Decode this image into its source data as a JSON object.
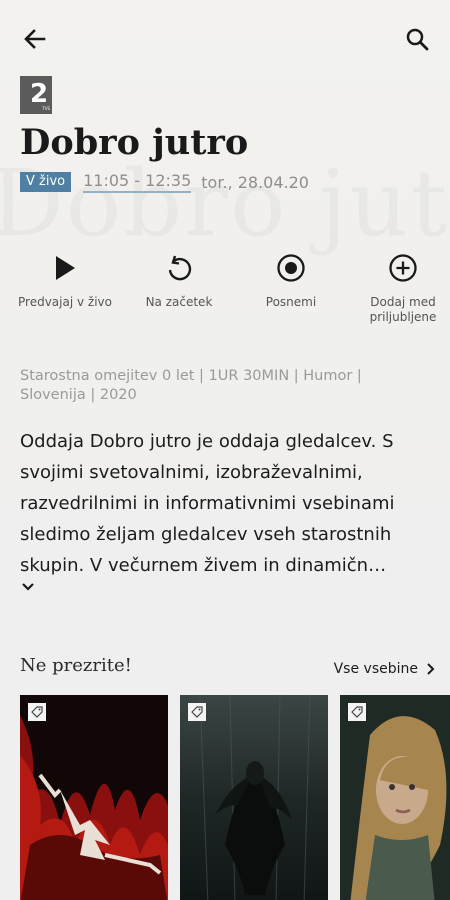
{
  "header": {
    "back_icon": "arrow-left-icon",
    "search_icon": "search-icon"
  },
  "channel": {
    "logo_number": "2",
    "logo_sub": "TVS"
  },
  "program": {
    "watermark": "Dobro jutro",
    "title": "Dobro jutro",
    "live_badge": "V živo",
    "time": "11:05 - 12:35",
    "date": "tor., 28.04.20",
    "info": "Starostna omejitev 0 let | 1UR 30MIN | Humor | Slovenija | 2020",
    "description": "Oddaja Dobro jutro je oddaja gledalcev. S svojimi svetovalnimi, izobraževalnimi, razvedrilnimi in informativnimi vsebinami sledimo željam gledalcev vseh starostnih skupin. V večurnem živem in dinamičn…"
  },
  "actions": [
    {
      "label": "Predvajaj v živo",
      "icon": "play-icon"
    },
    {
      "label": "Na začetek",
      "icon": "restart-icon"
    },
    {
      "label": "Posnemi",
      "icon": "record-icon"
    },
    {
      "label": "Dodaj med priljubljene",
      "icon": "add-circle-icon"
    }
  ],
  "recommendations": {
    "title": "Ne prezrite!",
    "link": "Vse vsebine",
    "items": [
      {
        "name": "poster-1",
        "icon": "tag-icon"
      },
      {
        "name": "poster-2",
        "icon": "tag-icon"
      },
      {
        "name": "poster-3",
        "icon": "tag-icon"
      }
    ]
  },
  "colors": {
    "accent": "#4f7fa3",
    "time_underline": "#8fb2cc"
  }
}
